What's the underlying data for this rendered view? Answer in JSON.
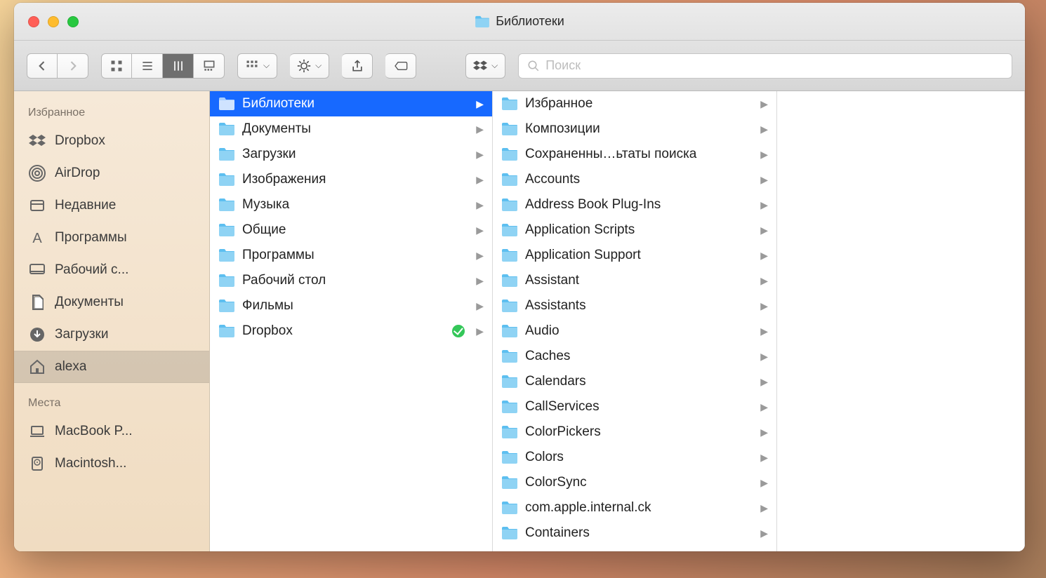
{
  "window": {
    "title": "Библиотеки"
  },
  "toolbar": {
    "search_placeholder": "Поиск"
  },
  "sidebar": {
    "section_favorites": "Избранное",
    "section_locations": "Места",
    "favorites": [
      {
        "label": "Dropbox",
        "icon": "dropbox"
      },
      {
        "label": "AirDrop",
        "icon": "airdrop"
      },
      {
        "label": "Недавние",
        "icon": "recents"
      },
      {
        "label": "Программы",
        "icon": "apps"
      },
      {
        "label": "Рабочий с...",
        "icon": "desktop"
      },
      {
        "label": "Документы",
        "icon": "documents"
      },
      {
        "label": "Загрузки",
        "icon": "downloads"
      },
      {
        "label": "alexa",
        "icon": "home",
        "selected": true
      }
    ],
    "locations": [
      {
        "label": "MacBook P...",
        "icon": "laptop"
      },
      {
        "label": "Macintosh...",
        "icon": "hdd"
      }
    ]
  },
  "columns": [
    [
      {
        "label": "Библиотеки",
        "selected": true,
        "has_children": true
      },
      {
        "label": "Документы",
        "has_children": true
      },
      {
        "label": "Загрузки",
        "has_children": true
      },
      {
        "label": "Изображения",
        "has_children": true
      },
      {
        "label": "Музыка",
        "has_children": true
      },
      {
        "label": "Общие",
        "has_children": true
      },
      {
        "label": "Программы",
        "has_children": true
      },
      {
        "label": "Рабочий стол",
        "has_children": true
      },
      {
        "label": "Фильмы",
        "has_children": true
      },
      {
        "label": "Dropbox",
        "has_children": true,
        "sync_ok": true
      }
    ],
    [
      {
        "label": "Избранное",
        "has_children": true
      },
      {
        "label": "Композиции",
        "has_children": true
      },
      {
        "label": "Сохраненны…ьтаты поиска",
        "has_children": true
      },
      {
        "label": "Accounts",
        "has_children": true
      },
      {
        "label": "Address Book Plug-Ins",
        "has_children": true
      },
      {
        "label": "Application Scripts",
        "has_children": true
      },
      {
        "label": "Application Support",
        "has_children": true
      },
      {
        "label": "Assistant",
        "has_children": true
      },
      {
        "label": "Assistants",
        "has_children": true
      },
      {
        "label": "Audio",
        "has_children": true
      },
      {
        "label": "Caches",
        "has_children": true
      },
      {
        "label": "Calendars",
        "has_children": true
      },
      {
        "label": "CallServices",
        "has_children": true
      },
      {
        "label": "ColorPickers",
        "has_children": true
      },
      {
        "label": "Colors",
        "has_children": true
      },
      {
        "label": "ColorSync",
        "has_children": true
      },
      {
        "label": "com.apple.internal.ck",
        "has_children": true
      },
      {
        "label": "Containers",
        "has_children": true
      }
    ]
  ]
}
